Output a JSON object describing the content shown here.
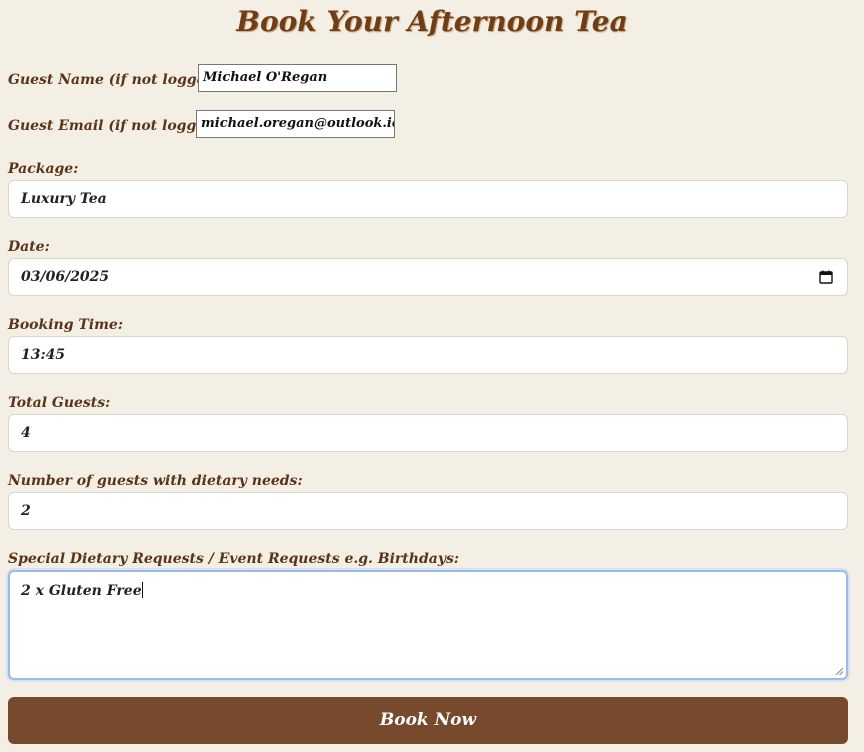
{
  "title": "Book Your Afternoon Tea",
  "guest_name": {
    "label": "Guest Name (if not logged in):",
    "value": "Michael O'Regan"
  },
  "guest_email": {
    "label": "Guest Email (if not logged in):",
    "value": "michael.oregan@outlook.ie"
  },
  "package": {
    "label": "Package:",
    "value": "Luxury Tea"
  },
  "date": {
    "label": "Date:",
    "value": "03/06/2025"
  },
  "booking_time": {
    "label": "Booking Time:",
    "value": "13:45"
  },
  "total_guests": {
    "label": "Total Guests:",
    "value": "4"
  },
  "dietary_guests": {
    "label": "Number of guests with dietary needs:",
    "value": "2"
  },
  "special_requests": {
    "label": "Special Dietary Requests / Event Requests e.g. Birthdays:",
    "value": "2 x Gluten Free"
  },
  "submit_label": "Book Now",
  "icons": {
    "date": "calendar-icon"
  },
  "colors": {
    "background": "#f3efe4",
    "title": "#6f3d17",
    "button": "#774a2e",
    "focus_ring": "#9fbbe3"
  }
}
